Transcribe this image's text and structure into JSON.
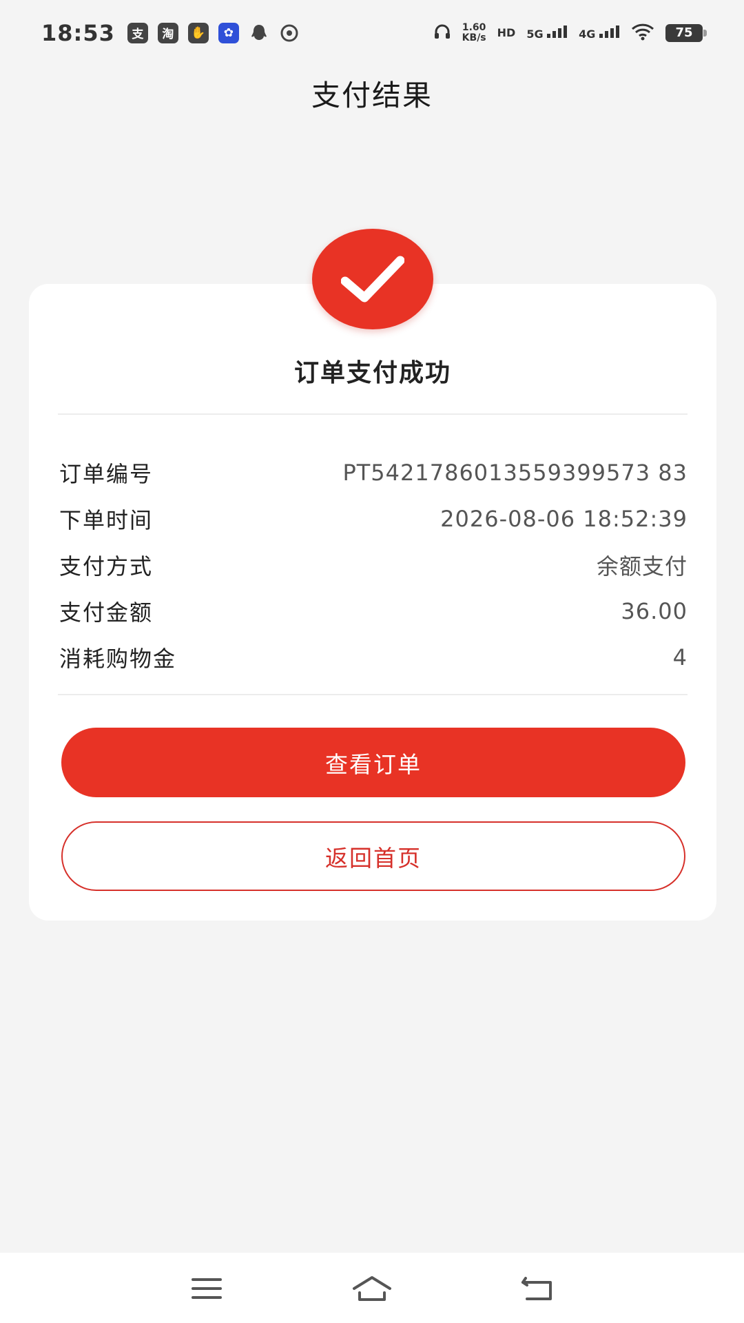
{
  "status_bar": {
    "time": "18:53",
    "left_icons": [
      {
        "name": "alipay-icon",
        "glyph": "支"
      },
      {
        "name": "taobao-icon",
        "glyph": "淘"
      },
      {
        "name": "hand-app-icon",
        "glyph": "✋"
      },
      {
        "name": "blue-app-icon",
        "glyph": "✿"
      },
      {
        "name": "qq-icon",
        "glyph": "🐧"
      },
      {
        "name": "browser-app-icon",
        "glyph": "◉"
      }
    ],
    "speed_value": "1.60",
    "speed_unit": "KB/s",
    "hd_label": "HD",
    "network_5g": "5G",
    "network_4g": "4G",
    "battery": "75"
  },
  "header": {
    "title": "支付结果"
  },
  "result": {
    "message": "订单支付成功",
    "accent_color": "#e83325"
  },
  "order_info": [
    {
      "label": "订单编号",
      "value": "PT5421786013559399573 83"
    },
    {
      "label": "下单时间",
      "value": "2026-08-06 18:52:39"
    },
    {
      "label": "支付方式",
      "value": "余额支付"
    },
    {
      "label": "支付金额",
      "value": "36.00"
    },
    {
      "label": "消耗购物金",
      "value": "4"
    }
  ],
  "buttons": {
    "view_order": "查看订单",
    "back_home": "返回首页"
  },
  "nav": {
    "menu_icon": "menu-icon",
    "home_icon": "home-icon",
    "back_icon": "back-icon"
  }
}
